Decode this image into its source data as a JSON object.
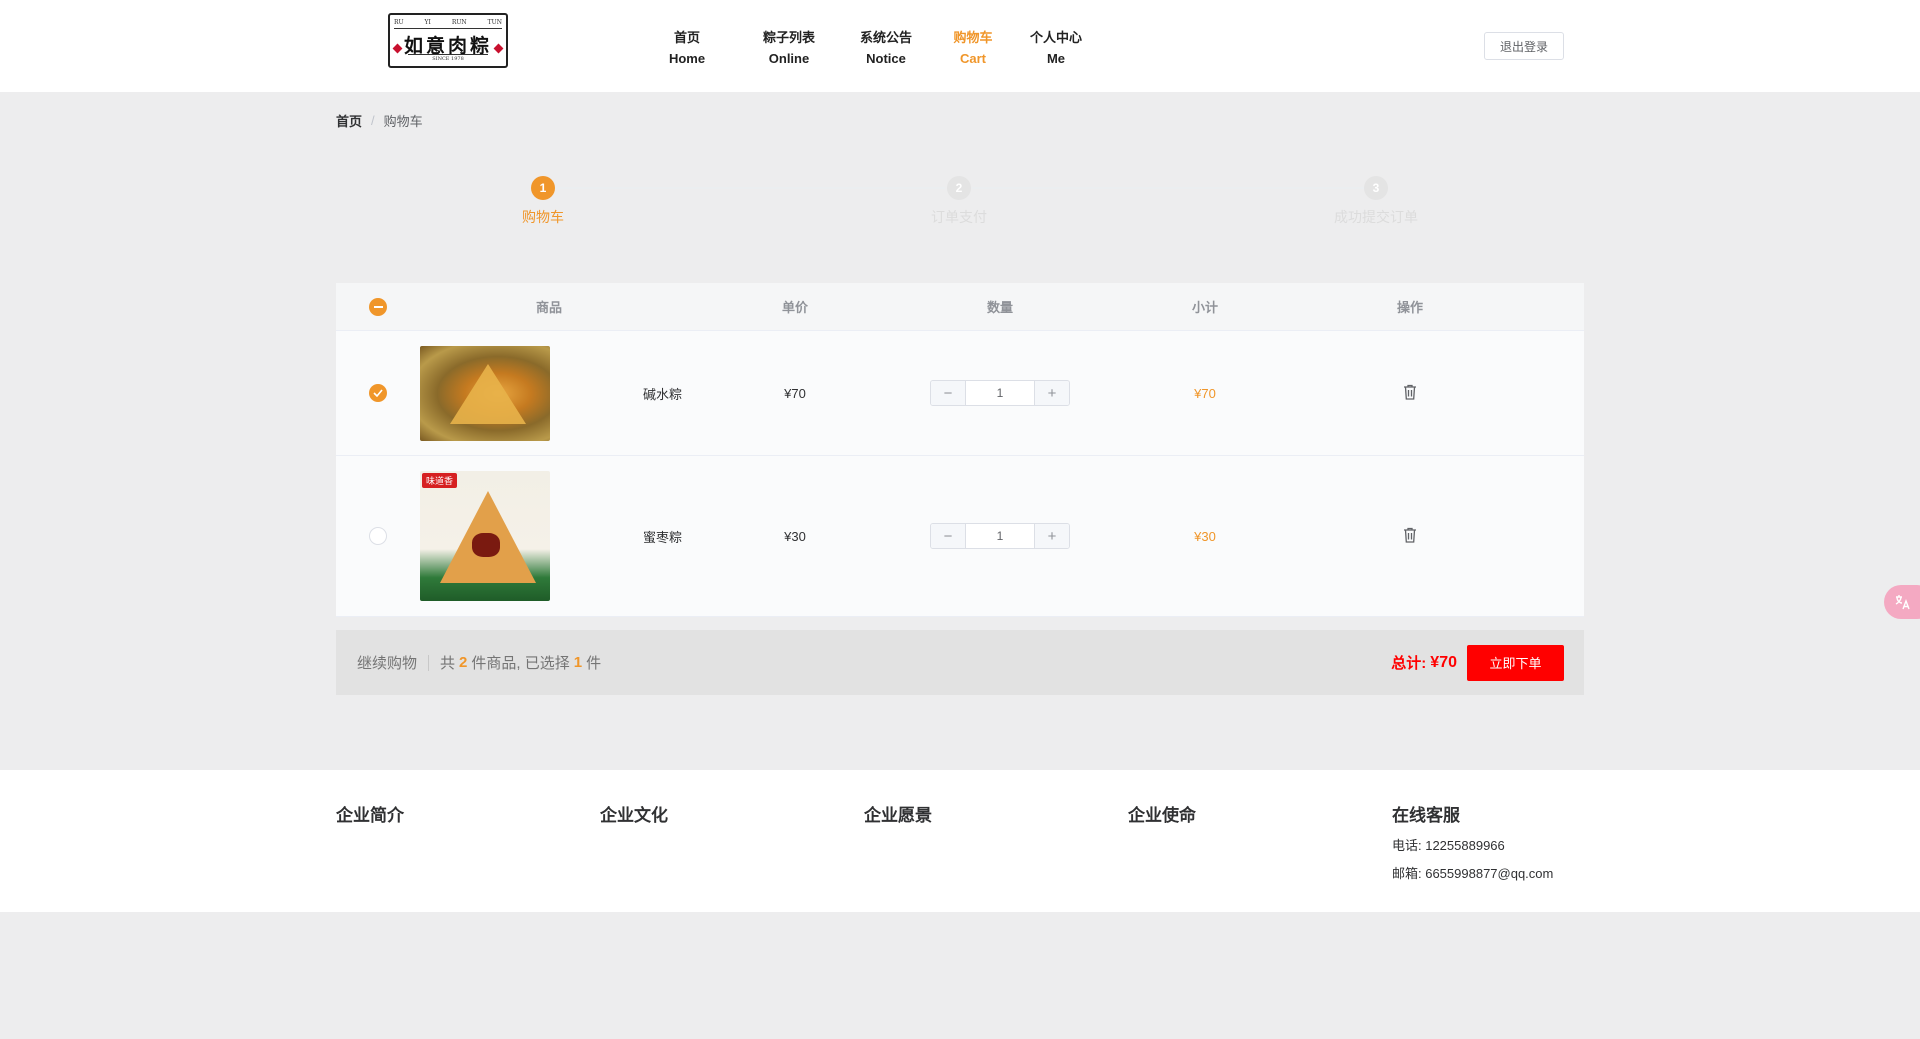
{
  "logo": {
    "top_text": [
      "RU",
      "YI",
      "RUN",
      "TUN"
    ],
    "brand": "如意肉粽",
    "since": "SINCE 1978"
  },
  "nav": [
    {
      "cn": "首页",
      "en": "Home"
    },
    {
      "cn": "粽子列表",
      "en": "Online"
    },
    {
      "cn": "系统公告",
      "en": "Notice"
    },
    {
      "cn": "购物车",
      "en": "Cart",
      "active": true
    },
    {
      "cn": "个人中心",
      "en": "Me"
    }
  ],
  "logout_label": "退出登录",
  "breadcrumb": {
    "home": "首页",
    "separator": "/",
    "current": "购物车"
  },
  "steps": [
    {
      "num": "1",
      "title": "购物车",
      "active": true
    },
    {
      "num": "2",
      "title": "订单支付",
      "active": false
    },
    {
      "num": "3",
      "title": "成功提交订单",
      "active": false
    }
  ],
  "table_headers": {
    "goods": "商品",
    "price": "单价",
    "qty": "数量",
    "subtotal": "小计",
    "action": "操作"
  },
  "cart_items": [
    {
      "name": "碱水粽",
      "price": "¥70",
      "qty": "1",
      "subtotal": "¥70",
      "checked": true
    },
    {
      "name": "蜜枣粽",
      "price": "¥30",
      "qty": "1",
      "subtotal": "¥30",
      "checked": false,
      "image_tag": "味道香"
    }
  ],
  "stepper": {
    "minus": "−",
    "plus": "+"
  },
  "summary": {
    "continue": "继续购物",
    "total_prefix": "共",
    "total_count": "2",
    "total_suffix": "件商品, 已选择",
    "selected_count": "1",
    "selected_suffix": "件",
    "total_label": "总计:",
    "total_value": "¥70",
    "order_button": "立即下单"
  },
  "footer": {
    "about": "企业简介",
    "culture": "企业文化",
    "vision": "企业愿景",
    "mission": "企业使命",
    "service": "在线客服",
    "phone": "电话:  12255889966",
    "email": "邮箱:  6655998877@qq.com"
  },
  "colors": {
    "accent": "#f0962a",
    "danger": "#ff0000",
    "background": "#ededee"
  }
}
